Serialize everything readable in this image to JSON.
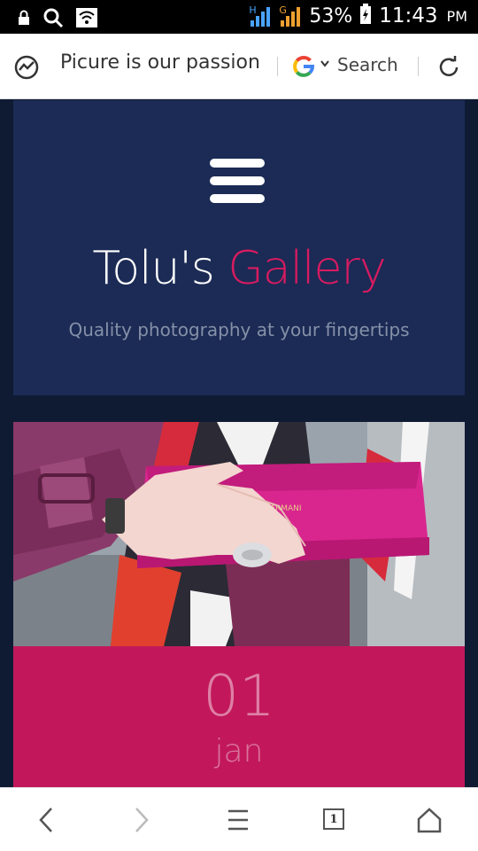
{
  "status_bar": {
    "network_label": "H",
    "network_label_2": "G",
    "battery": "53%",
    "time": "11:43",
    "ampm": "PM",
    "icons": [
      "lock-icon",
      "search-icon",
      "wifi-icon",
      "signal-icon",
      "battery-icon"
    ]
  },
  "browser": {
    "page_title": "Picure is our passion",
    "search_label": "Search",
    "icons": [
      "site-icon",
      "google-icon",
      "chevron-down-icon",
      "refresh-icon"
    ]
  },
  "hero": {
    "title_main": "Tolu's ",
    "title_accent": "Gallery",
    "subtitle": "Quality photography at your fingertips",
    "menu_icon": "hamburger-menu-icon"
  },
  "photo": {
    "brand_text": "EMPORIO ARMANI"
  },
  "date_card": {
    "day": "01",
    "month": "jan"
  },
  "bottom_nav": {
    "tab_count": "1",
    "icons": [
      "back-icon",
      "forward-icon",
      "menu-icon",
      "tabs-icon",
      "home-icon"
    ]
  },
  "colors": {
    "hero_bg": "#1b2b55",
    "page_bg": "#0f1b33",
    "accent": "#d81b60",
    "date_card_bg": "#c2185b"
  }
}
